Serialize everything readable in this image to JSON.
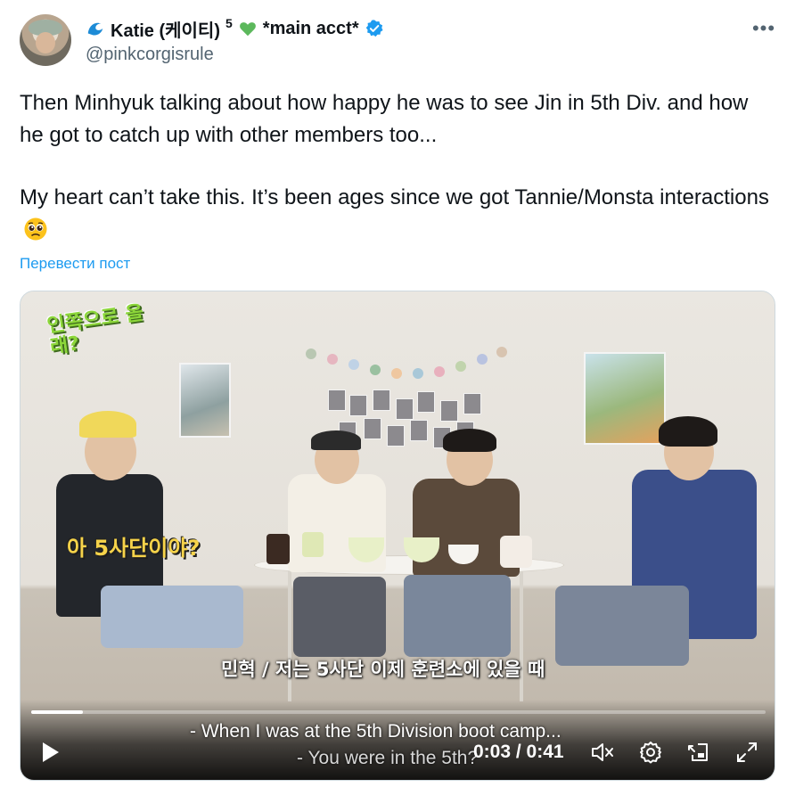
{
  "author": {
    "display_name": "Katie (케이티)",
    "superscript": "5",
    "name_suffix": "*main acct*",
    "handle": "@pinkcorgisrule",
    "icons": [
      "wave-icon",
      "green-heart-icon",
      "verified-badge-icon"
    ]
  },
  "tweet": {
    "paragraph1": "Then Minhyuk talking about how happy he was to see Jin in 5th Div. and how he got to catch up with other members too...",
    "paragraph2": "My heart can’t take this. It’s been ages since we got Tannie/Monsta interactions",
    "emoji": "pleading-face-emoji",
    "translate_link": "Перевести пост"
  },
  "video": {
    "show_logo": "인쪽으로 올래?",
    "speech_bubble": "아 5사단이야?",
    "korean_caption": "민혁 / 저는 5사단 이제 훈련소에 있을 때",
    "subtitle_line1": "- When I was at the 5th Division boot camp...",
    "subtitle_line2": "- You were in the 5th?",
    "current_time": "0:03",
    "duration": "0:41",
    "time_display": "0:03 / 0:41",
    "progress_fraction": 0.07,
    "controls": [
      "play-icon",
      "mute-icon",
      "settings-icon",
      "pip-icon",
      "fullscreen-icon"
    ]
  },
  "colors": {
    "link": "#1d9bf0",
    "verified": "#1d9bf0",
    "secondary_text": "#536471",
    "primary_text": "#0f1419"
  }
}
